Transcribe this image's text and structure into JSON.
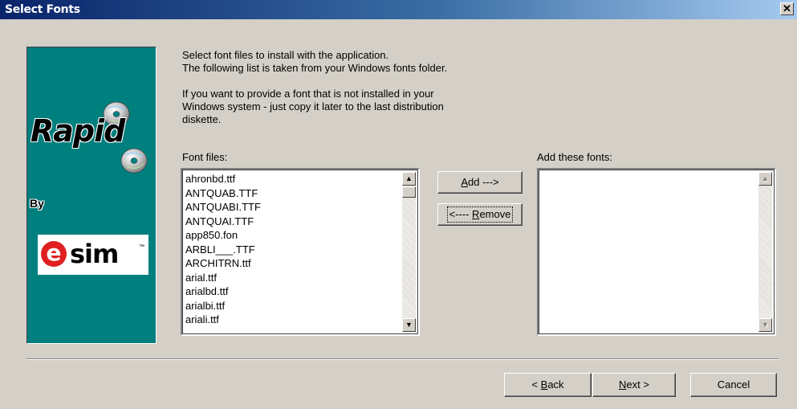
{
  "window": {
    "title": "Select Fonts",
    "close_glyph": "✕"
  },
  "logo": {
    "product": "Rapid",
    "by": "By",
    "brand_e": "e",
    "brand_word": "sim",
    "tm": "™"
  },
  "instructions": {
    "line1": "Select font files to install with the application.",
    "line2": "The following list is taken from your Windows fonts folder.",
    "line3": "If you want to provide a font that is not installed in your",
    "line4": "Windows system - just copy it later to the last distribution",
    "line5": "diskette."
  },
  "font_files": {
    "label": "Font files:",
    "items": [
      "ahronbd.ttf",
      "ANTQUAB.TTF",
      "ANTQUABI.TTF",
      "ANTQUAI.TTF",
      "app850.fon",
      "ARBLI___.TTF",
      "ARCHITRN.ttf",
      "arial.ttf",
      "arialbd.ttf",
      "arialbi.ttf",
      "ariali.ttf"
    ]
  },
  "add_fonts": {
    "label": "Add these fonts:",
    "items": []
  },
  "buttons": {
    "add_mnemonic": "A",
    "add_rest": "dd --->",
    "remove_prefix": "<---- ",
    "remove_mnemonic": "R",
    "remove_rest": "emove",
    "back_prefix": "< ",
    "back_mnemonic": "B",
    "back_rest": "ack",
    "next_mnemonic": "N",
    "next_rest": "ext >",
    "cancel": "Cancel"
  },
  "icons": {
    "up_arrow": "▲",
    "down_arrow": "▼"
  }
}
